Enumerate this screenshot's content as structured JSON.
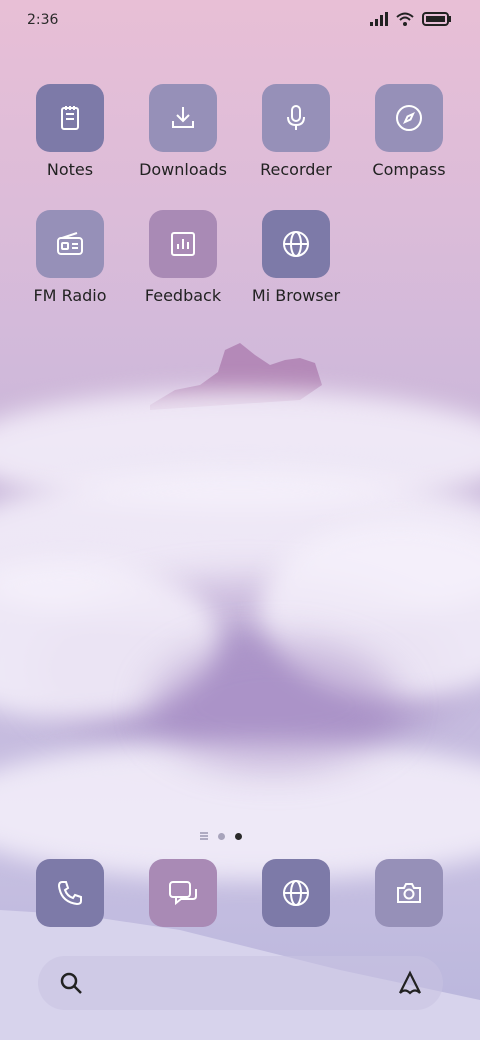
{
  "status_bar": {
    "time": "2:36"
  },
  "apps": [
    {
      "label": "Notes",
      "icon": "notes-icon",
      "color": "#7d7aa8"
    },
    {
      "label": "Downloads",
      "icon": "download-icon",
      "color": "#9690b8"
    },
    {
      "label": "Recorder",
      "icon": "microphone-icon",
      "color": "#9690b8"
    },
    {
      "label": "Compass",
      "icon": "compass-icon",
      "color": "#9690b8"
    },
    {
      "label": "FM Radio",
      "icon": "radio-icon",
      "color": "#9690b8"
    },
    {
      "label": "Feedback",
      "icon": "bar-chart-icon",
      "color": "#a98ab5"
    },
    {
      "label": "Mi Browser",
      "icon": "globe-icon",
      "color": "#7d7aa8"
    }
  ],
  "dock": [
    {
      "icon": "phone-icon",
      "color": "#7d7aa8"
    },
    {
      "icon": "messages-icon",
      "color": "#a98ab5"
    },
    {
      "icon": "globe-icon",
      "color": "#7d7aa8"
    },
    {
      "icon": "camera-icon",
      "color": "#9690b8"
    }
  ],
  "page_indicator": {
    "pages": 2,
    "active": 2
  }
}
